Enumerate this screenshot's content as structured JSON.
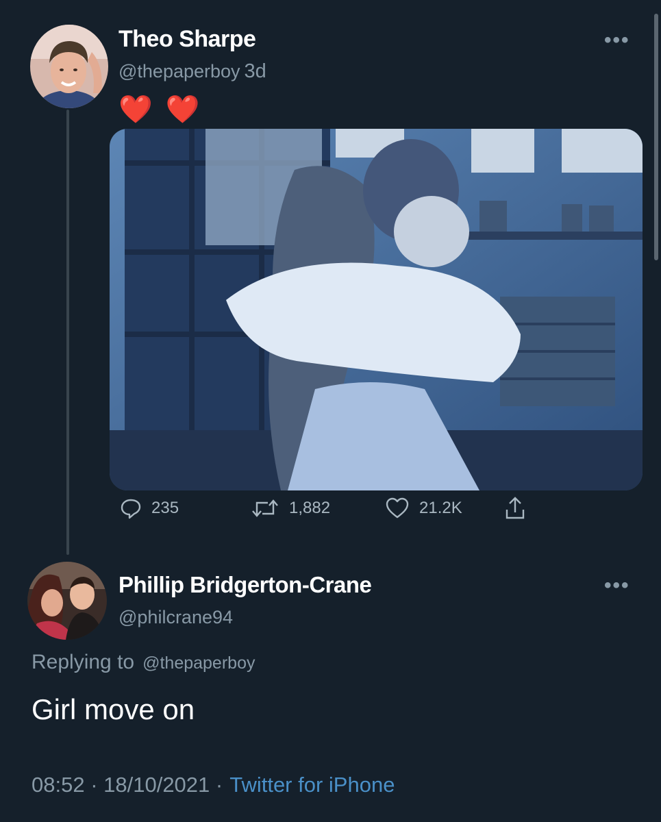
{
  "tweet": {
    "author_name": "Theo Sharpe",
    "author_handle": "@thepaperboy",
    "time_ago": "3d",
    "text": "❤️ ❤️",
    "actions": {
      "replies": "235",
      "retweets": "1,882",
      "likes": "21.2K"
    }
  },
  "reply": {
    "author_name": "Phillip Bridgerton-Crane",
    "author_handle": "@philcrane94",
    "replying_to_label": "Replying to",
    "replying_to_handle": "@thepaperboy",
    "text": "Girl move on",
    "timestamp": "08:52 · 18/10/2021 ·",
    "source": "Twitter for iPhone"
  },
  "icons": {
    "more": "more-dots-icon",
    "reply": "reply-bubble-icon",
    "retweet": "retweet-icon",
    "like": "heart-outline-icon",
    "share": "share-upload-icon"
  },
  "colors": {
    "background": "#15202b",
    "secondary_text": "#8899a6",
    "link": "#4a90c8",
    "heart": "#e0245e"
  }
}
